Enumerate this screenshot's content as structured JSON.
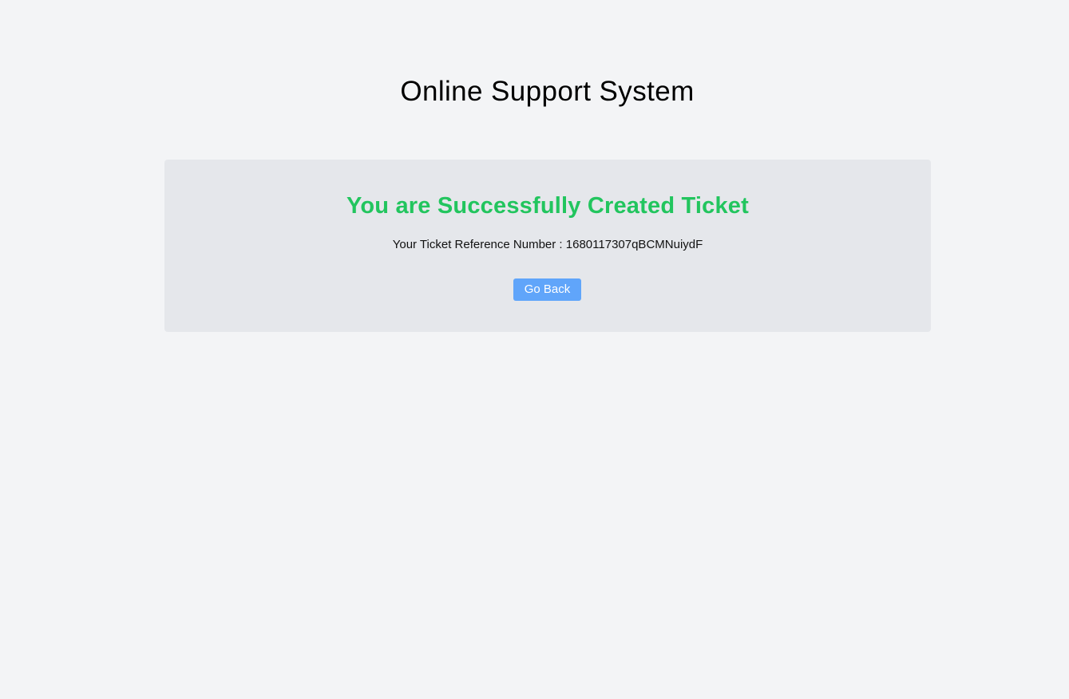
{
  "header": {
    "title": "Online Support System"
  },
  "ticket_card": {
    "heading": "You are Successfully Created Ticket",
    "reference_label": "Your Ticket Reference Number",
    "reference_separator": " : ",
    "reference_number": "1680117307qBCMNuiydF",
    "go_back_label": "Go Back"
  },
  "colors": {
    "page_background": "#f3f4f6",
    "card_background": "#e5e7eb",
    "success_green": "#22c55e",
    "button_blue": "#60a5fa"
  }
}
